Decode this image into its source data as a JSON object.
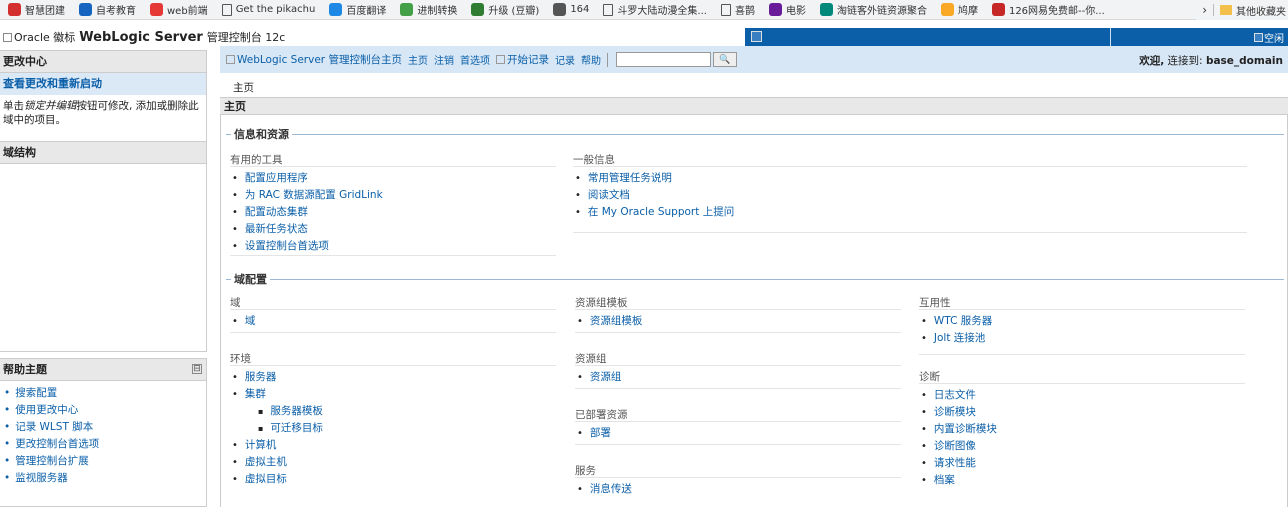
{
  "bookmarks": [
    {
      "label": "智慧团建",
      "icon": "party-icon",
      "color": "#d32f2f"
    },
    {
      "label": "自考教育",
      "icon": "dash-icon",
      "color": "#1565c0"
    },
    {
      "label": "web前端",
      "icon": "swirl-icon",
      "color": "#e53935"
    },
    {
      "label": "Get the pikachu",
      "icon": "page-icon",
      "color": ""
    },
    {
      "label": "百度翻译",
      "icon": "translate-icon",
      "color": "#1e88e5"
    },
    {
      "label": "进制转换",
      "icon": "flower-icon",
      "color": "#43a047"
    },
    {
      "label": "升级 (豆瓣)",
      "icon": "douban-icon",
      "color": "#2e7d32"
    },
    {
      "label": "164",
      "icon": "globe-icon",
      "color": "#555555"
    },
    {
      "label": "斗罗大陆动漫全集...",
      "icon": "page-icon",
      "color": ""
    },
    {
      "label": "喜鹊",
      "icon": "page-icon",
      "color": ""
    },
    {
      "label": "电影",
      "icon": "6v-icon",
      "color": "#6a1b9a"
    },
    {
      "label": "淘链客外链资源聚合",
      "icon": "link-icon",
      "color": "#00897b"
    },
    {
      "label": "鸠摩",
      "icon": "book-icon",
      "color": "#f9a825"
    },
    {
      "label": "126网易免费邮--你...",
      "icon": "mail-icon",
      "color": "#c62828"
    }
  ],
  "bookmarks_more": "›",
  "bookmarks_other": "其他收藏夹",
  "header": {
    "brand_alt": "Oracle 徽标",
    "brand_name": "WebLogic Server",
    "brand_suffix": "管理控制台 12c",
    "status_alt": "空闲"
  },
  "change_center": {
    "title": "更改中心",
    "view_changes": "查看更改和重新启动",
    "desc_prefix": "单击",
    "desc_em": "锁定并编辑",
    "desc_suffix": "按钮可修改, 添加或删除此域中的项目。"
  },
  "domain_structure": {
    "title": "域结构"
  },
  "help": {
    "title": "帮助主题",
    "collapse": "⊟",
    "items": [
      "搜索配置",
      "使用更改中心",
      "记录 WLST 脚本",
      "更改控制台首选项",
      "管理控制台扩展",
      "监视服务器"
    ]
  },
  "toolbar": {
    "home_img_alt": "WebLogic Server 管理控制台主页",
    "home": "主页",
    "logout": "注销",
    "preferences": "首选项",
    "record_img_alt": "开始记录",
    "record": "记录",
    "help": "帮助",
    "search_value": "",
    "search_button": "🔍",
    "welcome": "欢迎,",
    "connected_label": "连接到:",
    "domain": "base_domain"
  },
  "breadcrumb": "主页",
  "main": {
    "title": "主页",
    "info_section": "信息和资源",
    "domain_config_section": "域配置",
    "useful_tools": {
      "title": "有用的工具",
      "items": [
        "配置应用程序",
        "为 RAC 数据源配置 GridLink",
        "配置动态集群",
        "最新任务状态",
        "设置控制台首选项"
      ]
    },
    "general_info": {
      "title": "一般信息",
      "items": [
        "常用管理任务说明",
        "阅读文档",
        "在 My Oracle Support 上提问"
      ]
    },
    "domain": {
      "title": "域",
      "items": [
        "域"
      ]
    },
    "environment": {
      "title": "环境",
      "items": [
        "服务器",
        "集群"
      ],
      "sub_items": [
        "服务器模板",
        "可迁移目标"
      ],
      "items_after": [
        "计算机",
        "虚拟主机",
        "虚拟目标"
      ]
    },
    "resource_group_templates": {
      "title": "资源组模板",
      "items": [
        "资源组模板"
      ]
    },
    "resource_groups": {
      "title": "资源组",
      "items": [
        "资源组"
      ]
    },
    "deployed_resources": {
      "title": "已部署资源",
      "items": [
        "部署"
      ]
    },
    "services": {
      "title": "服务",
      "items": [
        "消息传送"
      ]
    },
    "interoperability": {
      "title": "互用性",
      "items": [
        "WTC 服务器",
        "Jolt 连接池"
      ]
    },
    "diagnostics": {
      "title": "诊断",
      "items": [
        "日志文件",
        "诊断模块",
        "内置诊断模块",
        "诊断图像",
        "请求性能",
        "档案"
      ]
    }
  }
}
